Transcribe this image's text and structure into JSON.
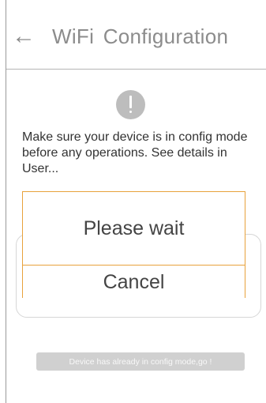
{
  "header": {
    "back_icon": "back-arrow-icon",
    "back_glyph": "←",
    "title": "WiFi  Configuration"
  },
  "notice": {
    "icon": "exclamation-circle-icon",
    "message": "Make sure your device is in config mode before any operations. See details in User..."
  },
  "dialog": {
    "message": "Please wait",
    "cancel_label": "Cancel",
    "border_color": "#e8a23c"
  },
  "footer": {
    "config_button_label": "Device has already in config mode,go !"
  },
  "colors": {
    "title": "#8c8c8c",
    "icon_gray": "#bdbdbd",
    "button_gray": "#d0d0d0"
  }
}
